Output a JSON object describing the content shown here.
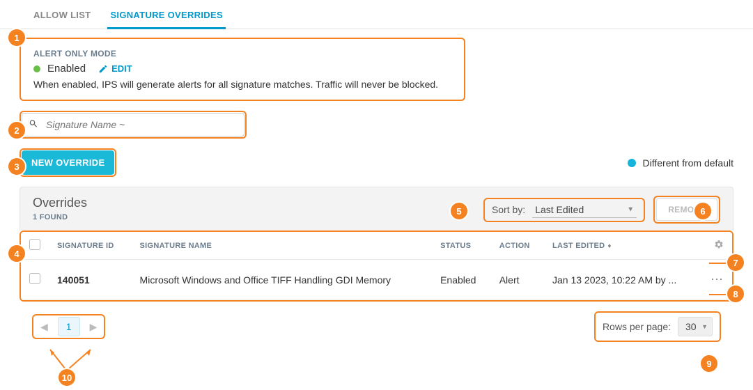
{
  "tabs": {
    "allow_list": "ALLOW LIST",
    "signature_overrides": "SIGNATURE OVERRIDES"
  },
  "alert_card": {
    "header": "ALERT ONLY MODE",
    "status": "Enabled",
    "edit": "EDIT",
    "desc": "When enabled, IPS will generate alerts for all signature matches. Traffic will never be blocked."
  },
  "search": {
    "placeholder": "Signature Name ~"
  },
  "new_override": "NEW OVERRIDE",
  "legend": "Different from default",
  "panel": {
    "title": "Overrides",
    "found": "1 FOUND",
    "sort_label": "Sort by:",
    "sort_value": "Last Edited",
    "remove": "REMOVE"
  },
  "table": {
    "headers": {
      "id": "SIGNATURE ID",
      "name": "SIGNATURE NAME",
      "status": "STATUS",
      "action": "ACTION",
      "edited": "LAST EDITED"
    },
    "rows": [
      {
        "id": "140051",
        "name": "Microsoft Windows and Office TIFF Handling GDI Memory",
        "status": "Enabled",
        "action": "Alert",
        "edited": "Jan 13 2023, 10:22 AM by ..."
      }
    ]
  },
  "pagination": {
    "page": "1",
    "rows_label": "Rows per page:",
    "rows_value": "30"
  },
  "callouts": [
    "1",
    "2",
    "3",
    "4",
    "5",
    "6",
    "7",
    "8",
    "9",
    "10"
  ]
}
